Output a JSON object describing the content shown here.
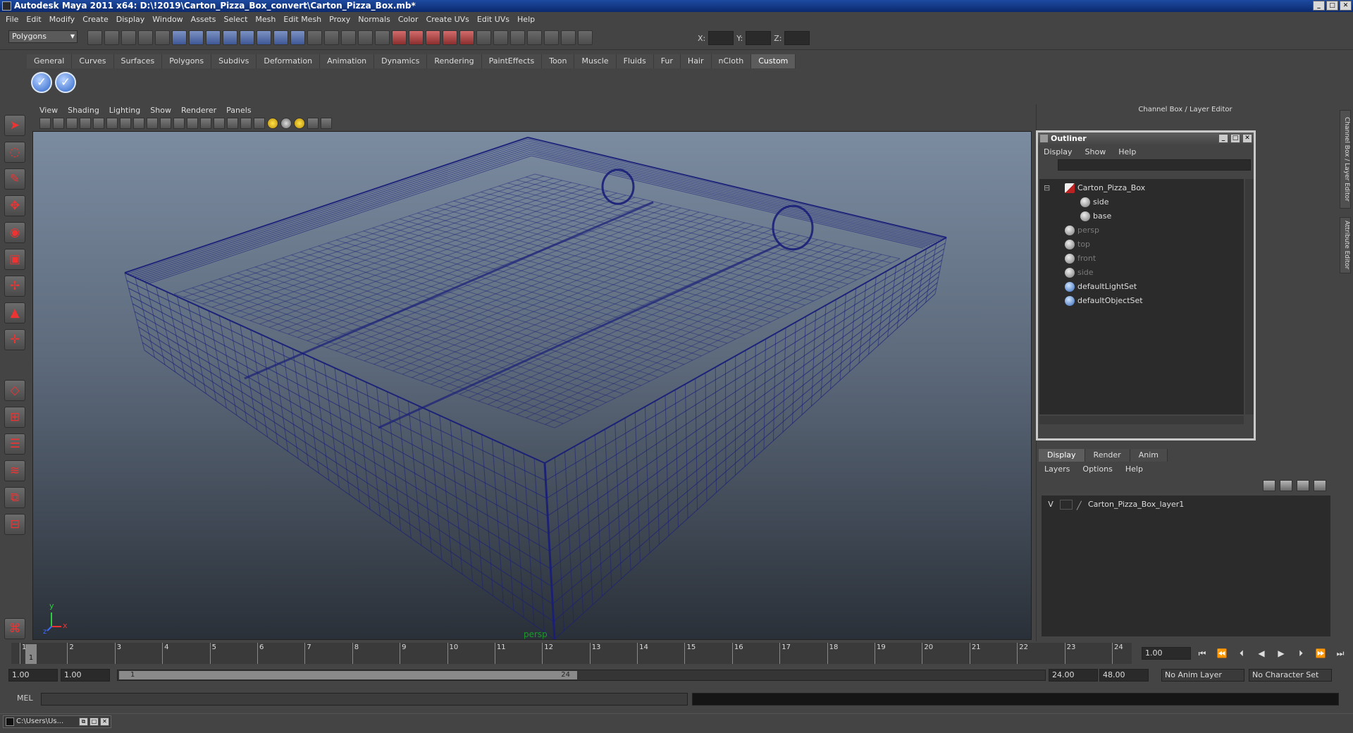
{
  "window": {
    "title": "Autodesk Maya 2011 x64: D:\\!2019\\Carton_Pizza_Box_convert\\Carton_Pizza_Box.mb*"
  },
  "menubar": [
    "File",
    "Edit",
    "Modify",
    "Create",
    "Display",
    "Window",
    "Assets",
    "Select",
    "Mesh",
    "Edit Mesh",
    "Proxy",
    "Normals",
    "Color",
    "Create UVs",
    "Edit UVs",
    "Help"
  ],
  "toolbar": {
    "mode": "Polygons",
    "x_label": "X:",
    "y_label": "Y:",
    "z_label": "Z:"
  },
  "shelf_tabs": [
    "General",
    "Curves",
    "Surfaces",
    "Polygons",
    "Subdivs",
    "Deformation",
    "Animation",
    "Dynamics",
    "Rendering",
    "PaintEffects",
    "Toon",
    "Muscle",
    "Fluids",
    "Fur",
    "Hair",
    "nCloth",
    "Custom"
  ],
  "shelf_active": "Custom",
  "viewport": {
    "menu": [
      "View",
      "Shading",
      "Lighting",
      "Show",
      "Renderer",
      "Panels"
    ],
    "camera_label": "persp",
    "axis_y": "y",
    "axis_x": "x",
    "axis_z": "z"
  },
  "channel_box": {
    "title": "Channel Box / Layer Editor"
  },
  "side_tabs": {
    "channel": "Channel Box / Layer Editor",
    "attribute": "Attribute Editor"
  },
  "outliner": {
    "title": "Outliner",
    "menu": [
      "Display",
      "Show",
      "Help"
    ],
    "items": [
      {
        "label": "Carton_Pizza_Box",
        "icon": "mesh-icon",
        "dim": false
      },
      {
        "label": "side",
        "icon": "shape-icon",
        "dim": false
      },
      {
        "label": "base",
        "icon": "shape-icon",
        "dim": false
      },
      {
        "label": "persp",
        "icon": "camera-icon",
        "dim": true
      },
      {
        "label": "top",
        "icon": "camera-icon",
        "dim": true
      },
      {
        "label": "front",
        "icon": "camera-icon",
        "dim": true
      },
      {
        "label": "side",
        "icon": "camera-icon",
        "dim": true
      },
      {
        "label": "defaultLightSet",
        "icon": "set-icon",
        "dim": false
      },
      {
        "label": "defaultObjectSet",
        "icon": "set-icon",
        "dim": false
      }
    ]
  },
  "layers": {
    "tabs": [
      "Display",
      "Render",
      "Anim"
    ],
    "menu": [
      "Layers",
      "Options",
      "Help"
    ],
    "rows": [
      {
        "visible": "V",
        "name": "Carton_Pizza_Box_layer1"
      }
    ]
  },
  "timeline": {
    "ticks": [
      "1",
      "2",
      "3",
      "4",
      "5",
      "6",
      "7",
      "8",
      "9",
      "10",
      "11",
      "12",
      "13",
      "14",
      "15",
      "16",
      "17",
      "18",
      "19",
      "20",
      "21",
      "22",
      "23",
      "24"
    ],
    "current_frame": "1",
    "current_time": "1.00"
  },
  "range": {
    "start_time": "1.00",
    "playback_start": "1.00",
    "slider_start": "1",
    "slider_end": "24",
    "playback_end": "24.00",
    "end_time": "48.00",
    "anim_layer": "No Anim Layer",
    "character_set": "No Character Set"
  },
  "command": {
    "label": "MEL"
  },
  "taskbar": {
    "item": "C:\\Users\\Us..."
  }
}
